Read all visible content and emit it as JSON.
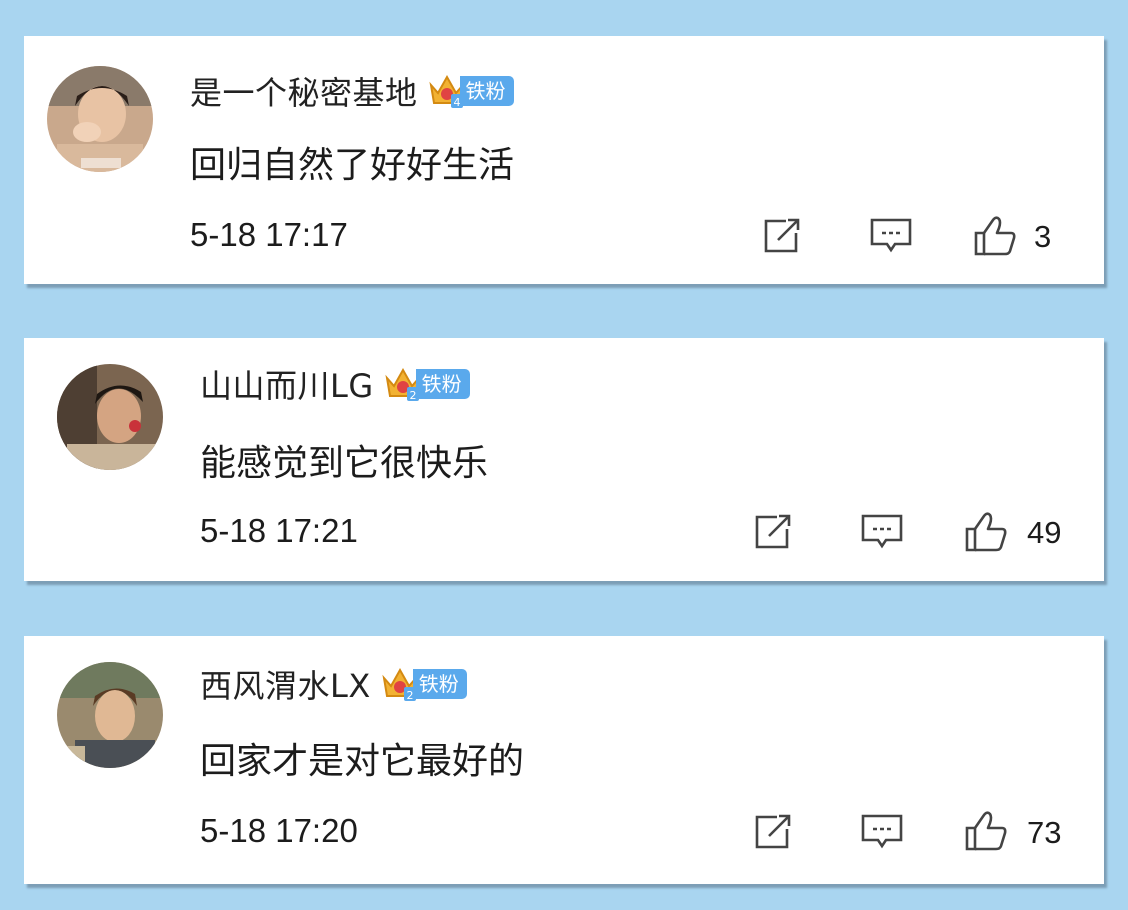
{
  "comments": [
    {
      "username": "是一个秘密基地",
      "badge": {
        "level": "4",
        "label": "铁粉"
      },
      "text": "回归自然了好好生活",
      "timestamp": "5-18 17:17",
      "likes": "3"
    },
    {
      "username": "山山而川LG",
      "badge": {
        "level": "2",
        "label": "铁粉"
      },
      "text": "能感觉到它很快乐",
      "timestamp": "5-18 17:21",
      "likes": "49"
    },
    {
      "username": "西风渭水LX",
      "badge": {
        "level": "2",
        "label": "铁粉"
      },
      "text": "回家才是对它最好的",
      "timestamp": "5-18 17:20",
      "likes": "73"
    }
  ],
  "icons": {
    "share": "share-icon",
    "reply": "comment-icon",
    "like": "thumbs-up-icon",
    "badge": "crown-icon"
  },
  "colors": {
    "background": "#a9d5f0",
    "card": "#ffffff",
    "badge": "#5aa9ec",
    "crown": "#f2b233"
  }
}
